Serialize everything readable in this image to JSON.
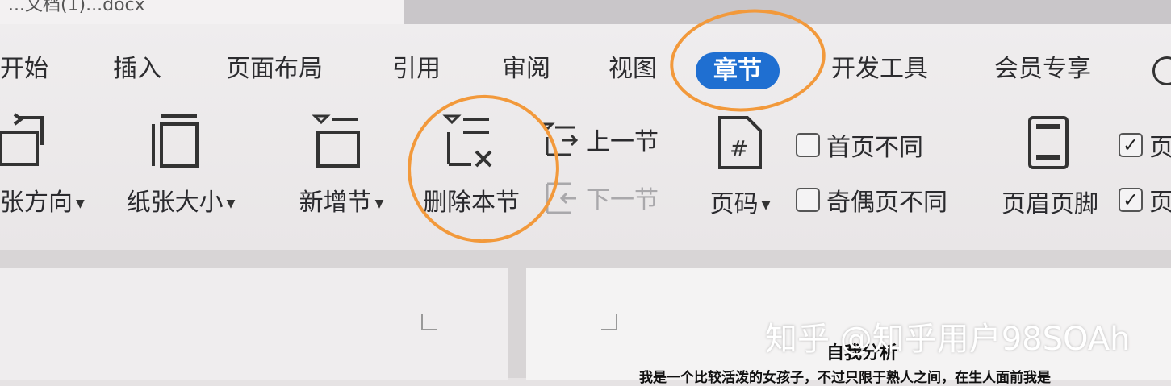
{
  "title_bar": {
    "doc_title": "...文档(1)...docx"
  },
  "tabs": [
    {
      "label": "开始",
      "active": false
    },
    {
      "label": "插入",
      "active": false
    },
    {
      "label": "页面布局",
      "active": false
    },
    {
      "label": "引用",
      "active": false
    },
    {
      "label": "审阅",
      "active": false
    },
    {
      "label": "视图",
      "active": false
    },
    {
      "label": "章节",
      "active": true
    },
    {
      "label": "开发工具",
      "active": false
    },
    {
      "label": "会员专享",
      "active": false
    }
  ],
  "tools": {
    "orientation": {
      "label": "张方向",
      "icon": "page-orientation-icon"
    },
    "paper_size": {
      "label": "纸张大小",
      "icon": "paper-size-icon"
    },
    "new_section": {
      "label": "新增节",
      "icon": "add-section-icon"
    },
    "delete_section": {
      "label": "删除本节",
      "icon": "delete-section-icon"
    },
    "prev_section": {
      "label": "上一节",
      "icon": "prev-section-icon",
      "enabled": true
    },
    "next_section": {
      "label": "下一节",
      "icon": "next-section-icon",
      "enabled": false
    },
    "page_number": {
      "label": "页码",
      "icon": "page-number-icon"
    },
    "header_footer": {
      "label": "页眉页脚",
      "icon": "header-footer-icon"
    }
  },
  "checkboxes": {
    "first_page_diff": {
      "label": "首页不同",
      "checked": false
    },
    "odd_even_diff": {
      "label": "奇偶页不同",
      "checked": false
    },
    "right_top": {
      "label": "页",
      "checked": true
    },
    "right_bottom": {
      "label": "页",
      "checked": true
    }
  },
  "document": {
    "heading": "自我分析",
    "first_line": "我是一个比较活泼的女孩子，不过只限于熟人之间，在生人面前我是"
  },
  "watermark": "知乎 @知乎用户98SOAh",
  "colors": {
    "accent": "#1f6fd1",
    "annotation": "#f2993b"
  }
}
